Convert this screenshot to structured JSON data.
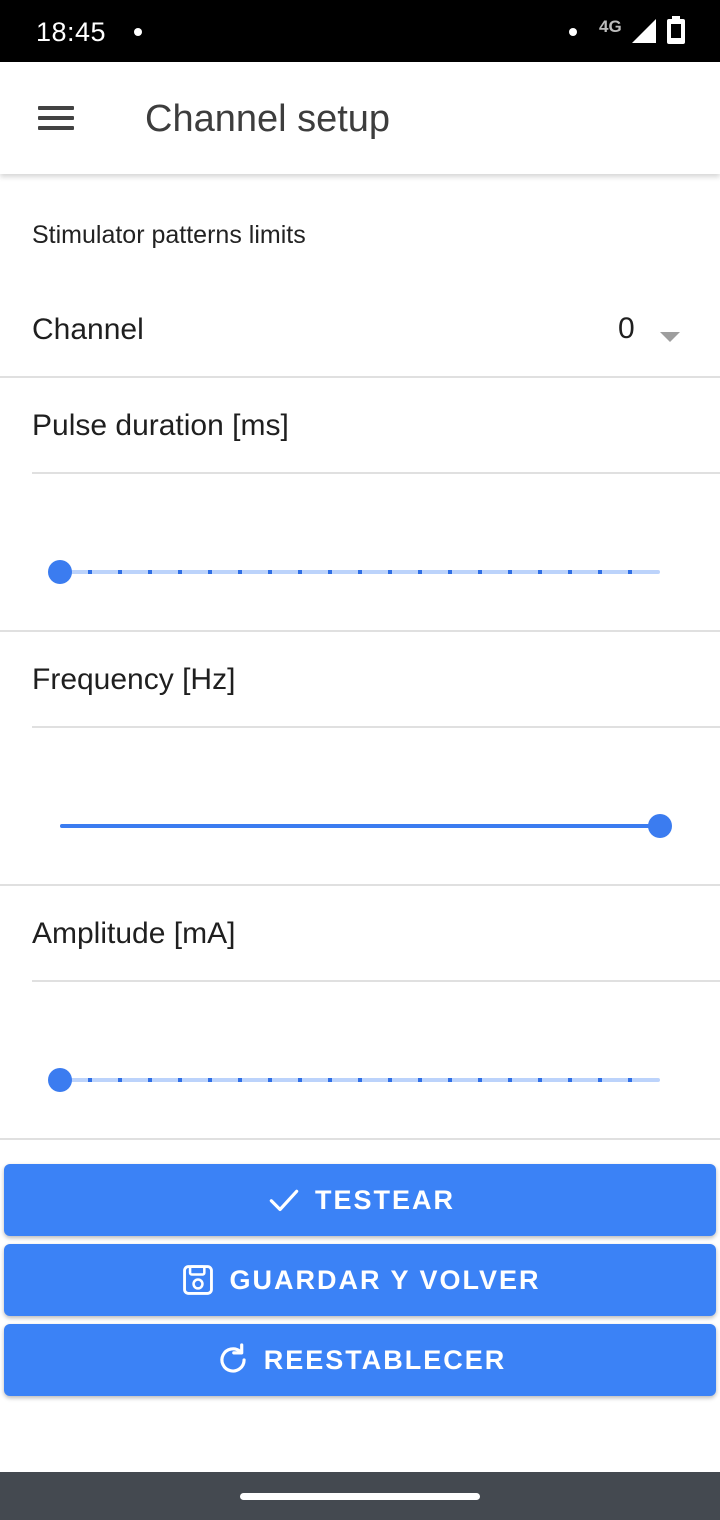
{
  "status_bar": {
    "time": "18:45",
    "network": "4G"
  },
  "app_bar": {
    "title": "Channel setup",
    "menu_icon": "hamburger-menu-icon"
  },
  "content": {
    "section_title": "Stimulator patterns limits",
    "channel": {
      "label": "Channel",
      "value": "0"
    },
    "params": [
      {
        "label": "Pulse duration [ms]",
        "slider_value_fraction": 0.0,
        "discrete_steps": 21
      },
      {
        "label": "Frequency [Hz]",
        "slider_value_fraction": 1.0,
        "discrete_steps": 0
      },
      {
        "label": "Amplitude [mA]",
        "slider_value_fraction": 0.0,
        "discrete_steps": 21
      }
    ]
  },
  "actions": {
    "test": {
      "label": "TESTEAR",
      "icon": "check-icon"
    },
    "save": {
      "label": "GUARDAR Y VOLVER",
      "icon": "save-icon"
    },
    "reset": {
      "label": "REESTABLECER",
      "icon": "refresh-icon"
    }
  },
  "colors": {
    "accent": "#3b82f6",
    "slider_active": "#3b7cf0",
    "slider_inactive": "#bcd3fb"
  }
}
